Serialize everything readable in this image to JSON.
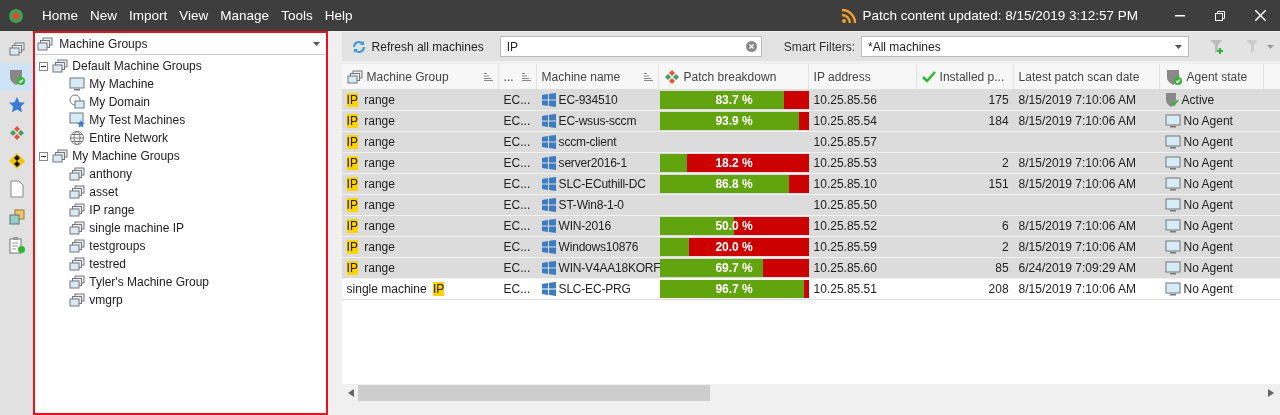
{
  "menu_bar": {
    "items": [
      "Home",
      "New",
      "Import",
      "View",
      "Manage",
      "Tools",
      "Help"
    ],
    "status": "Patch content updated: 8/15/2019 3:12:57 PM"
  },
  "nav_strip": [
    {
      "kind": "groups",
      "selected": false
    },
    {
      "kind": "shield",
      "selected": true
    },
    {
      "kind": "star",
      "selected": false
    },
    {
      "kind": "patch",
      "selected": false
    },
    {
      "kind": "diamond",
      "selected": false
    },
    {
      "kind": "page",
      "selected": false
    },
    {
      "kind": "squares",
      "selected": false
    },
    {
      "kind": "clipboard",
      "selected": false
    }
  ],
  "group_panel": {
    "dropdown": "Machine Groups",
    "tree": [
      {
        "label": "Default Machine Groups",
        "kind": "groups",
        "expanded": true,
        "children": [
          {
            "label": "My Machine",
            "kind": "monitor"
          },
          {
            "label": "My Domain",
            "kind": "domain"
          },
          {
            "label": "My Test Machines",
            "kind": "test"
          },
          {
            "label": "Entire Network",
            "kind": "globe"
          }
        ]
      },
      {
        "label": "My Machine Groups",
        "kind": "groups",
        "expanded": true,
        "children": [
          {
            "label": "anthony",
            "kind": "groups"
          },
          {
            "label": "asset",
            "kind": "groups"
          },
          {
            "label": "IP range",
            "kind": "groups"
          },
          {
            "label": "single machine IP",
            "kind": "groups"
          },
          {
            "label": "testgroups",
            "kind": "groups"
          },
          {
            "label": "testred",
            "kind": "groups"
          },
          {
            "label": "Tyler's Machine Group",
            "kind": "groups"
          },
          {
            "label": "vmgrp",
            "kind": "groups"
          }
        ]
      }
    ]
  },
  "toolbar": {
    "refresh": "Refresh all machines",
    "search": "IP",
    "smart_filters_label": "Smart Filters:",
    "smart_filter": "*All machines"
  },
  "table": {
    "columns": [
      "Machine Group",
      "...",
      "Machine name",
      "Patch breakdown",
      "IP address",
      "Installed p...",
      "Latest patch scan date",
      "Agent state"
    ],
    "rows": [
      {
        "selected": true,
        "group": [
          {
            "text": "IP",
            "match": true
          },
          {
            "text": " range",
            "match": false
          }
        ],
        "domain": "EC...",
        "name": "EC-934510",
        "patch": {
          "level": 0.837,
          "text": "83.7 %"
        },
        "ip": "10.25.85.56",
        "installed": "175",
        "scan": "8/15/2019 7:10:06 AM",
        "agent": {
          "kind": "active",
          "text": "Active"
        }
      },
      {
        "selected": true,
        "group": [
          {
            "text": "IP",
            "match": true
          },
          {
            "text": " range",
            "match": false
          }
        ],
        "domain": "EC...",
        "name": "EC-wsus-sccm",
        "patch": {
          "level": 0.939,
          "text": "93.9 %"
        },
        "ip": "10.25.85.54",
        "installed": "184",
        "scan": "8/15/2019 7:10:06 AM",
        "agent": {
          "kind": "none",
          "text": "No Agent"
        }
      },
      {
        "selected": true,
        "group": [
          {
            "text": "IP",
            "match": true
          },
          {
            "text": " range",
            "match": false
          }
        ],
        "domain": "EC...",
        "name": "sccm-client",
        "ip": "10.25.85.57",
        "agent": {
          "kind": "none",
          "text": "No Agent"
        }
      },
      {
        "selected": true,
        "group": [
          {
            "text": "IP",
            "match": true
          },
          {
            "text": " range",
            "match": false
          }
        ],
        "domain": "EC...",
        "name": "server2016-1",
        "patch": {
          "level": 0.182,
          "text": "18.2 %"
        },
        "ip": "10.25.85.53",
        "installed": "2",
        "scan": "8/15/2019 7:10:06 AM",
        "agent": {
          "kind": "none",
          "text": "No Agent"
        }
      },
      {
        "selected": true,
        "group": [
          {
            "text": "IP",
            "match": true
          },
          {
            "text": " range",
            "match": false
          }
        ],
        "domain": "EC...",
        "name": "SLC-ECuthill-DC",
        "patch": {
          "level": 0.868,
          "text": "86.8 %"
        },
        "ip": "10.25.85.10",
        "installed": "151",
        "scan": "8/15/2019 7:10:06 AM",
        "agent": {
          "kind": "none",
          "text": "No Agent"
        }
      },
      {
        "selected": true,
        "group": [
          {
            "text": "IP",
            "match": true
          },
          {
            "text": " range",
            "match": false
          }
        ],
        "domain": "EC...",
        "name": "ST-Win8-1-0",
        "ip": "10.25.85.50",
        "agent": {
          "kind": "none",
          "text": "No Agent"
        }
      },
      {
        "selected": true,
        "group": [
          {
            "text": "IP",
            "match": true
          },
          {
            "text": " range",
            "match": false
          }
        ],
        "domain": "EC...",
        "name": "WIN-2016",
        "patch": {
          "level": 0.5,
          "text": "50.0 %"
        },
        "ip": "10.25.85.52",
        "installed": "6",
        "scan": "8/15/2019 7:10:06 AM",
        "agent": {
          "kind": "none",
          "text": "No Agent"
        }
      },
      {
        "selected": true,
        "group": [
          {
            "text": "IP",
            "match": true
          },
          {
            "text": " range",
            "match": false
          }
        ],
        "domain": "EC...",
        "name": "Windows10876",
        "patch": {
          "level": 0.2,
          "text": "20.0 %"
        },
        "ip": "10.25.85.59",
        "installed": "2",
        "scan": "8/15/2019 7:10:06 AM",
        "agent": {
          "kind": "none",
          "text": "No Agent"
        }
      },
      {
        "selected": true,
        "group": [
          {
            "text": "IP",
            "match": true
          },
          {
            "text": " range",
            "match": false
          }
        ],
        "domain": "EC...",
        "name": "WIN-V4AA18KORF",
        "patch": {
          "level": 0.697,
          "text": "69.7 %"
        },
        "ip": "10.25.85.60",
        "installed": "85",
        "scan": "6/24/2019 7:09:29 AM",
        "agent": {
          "kind": "none",
          "text": "No Agent"
        }
      },
      {
        "selected": false,
        "group": [
          {
            "text": "single machine ",
            "match": false
          },
          {
            "text": "IP",
            "match": true
          }
        ],
        "domain": "EC...",
        "name": "SLC-EC-PRG",
        "patch": {
          "level": 0.967,
          "text": "96.7 %"
        },
        "ip": "10.25.85.51",
        "installed": "208",
        "scan": "8/15/2019 7:10:06 AM",
        "agent": {
          "kind": "none",
          "text": "No Agent"
        }
      }
    ]
  }
}
